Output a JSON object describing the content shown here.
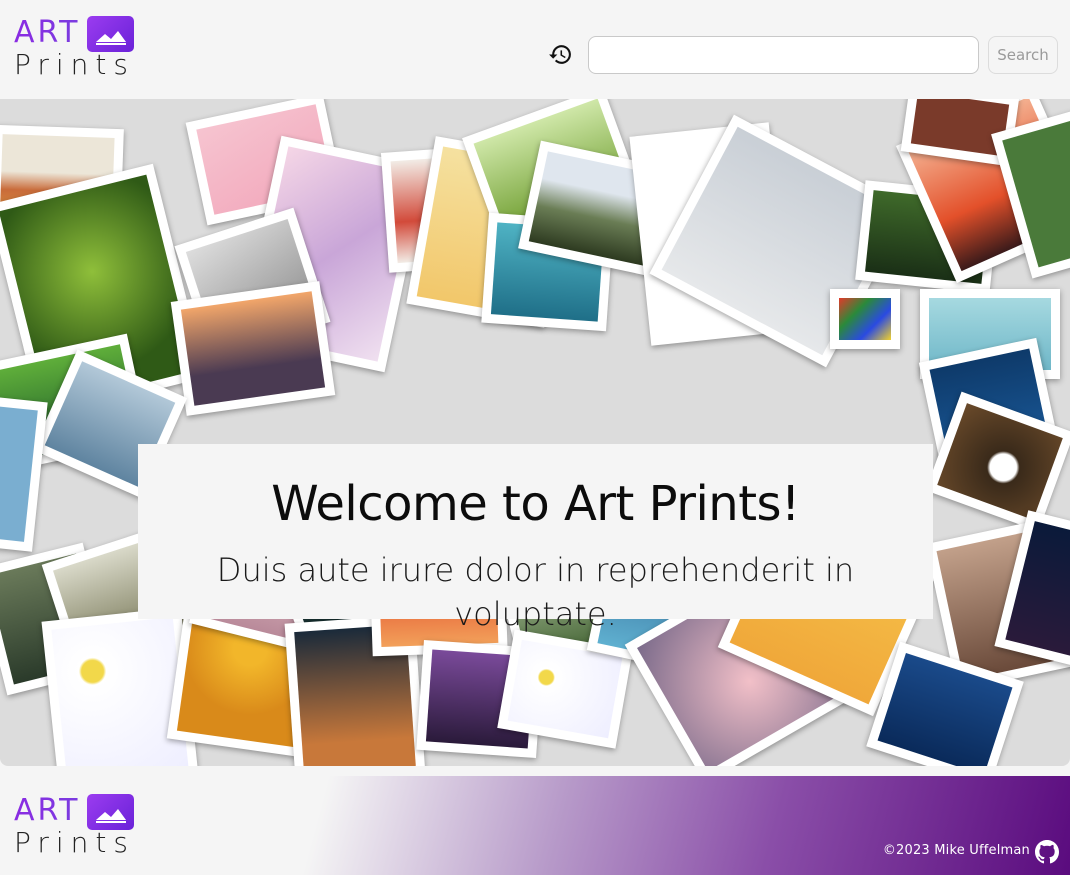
{
  "header": {
    "logo": {
      "top": "ART",
      "bottom": "Prints"
    },
    "history_icon": "history-icon",
    "search": {
      "value": "",
      "placeholder": "",
      "button_label": "Search"
    }
  },
  "hero": {
    "title": "Welcome to Art Prints!",
    "subtitle": "Duis aute irure dolor in reprehenderit in voluptate."
  },
  "footer": {
    "logo": {
      "top": "ART",
      "bottom": "Prints"
    },
    "copyright": "©2023  Mike Uffelman",
    "github_icon": "github-icon"
  },
  "colors": {
    "brand_purple": "#8a2be2",
    "footer_dark": "#5a0b7e",
    "background": "#f5f5f5"
  }
}
